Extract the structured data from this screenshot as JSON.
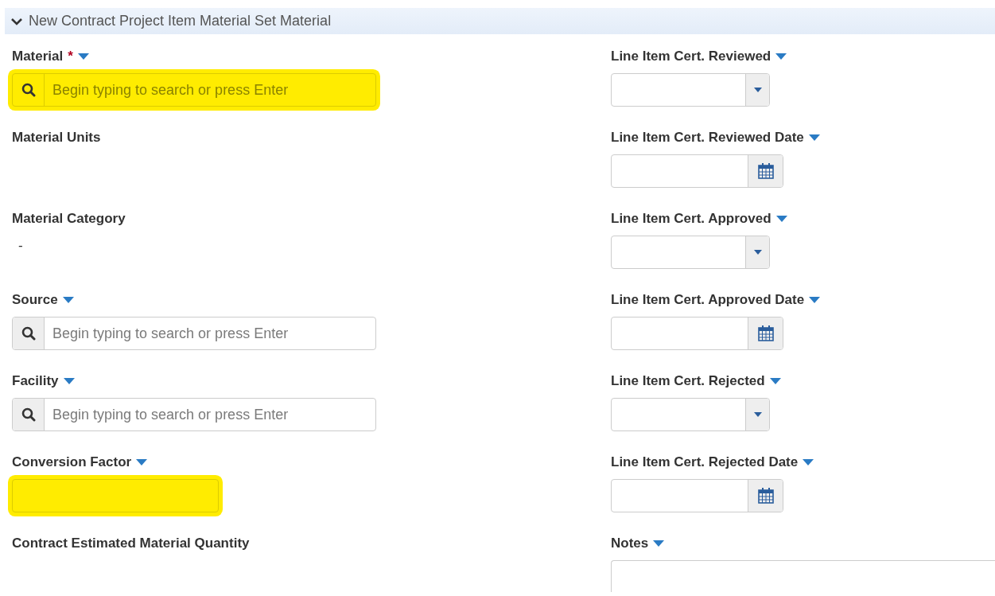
{
  "section": {
    "title": "New Contract Project Item Material Set Material",
    "expanded": true
  },
  "left_fields": [
    {
      "label": "Material",
      "required_mark": "*",
      "menu": true,
      "kind": "search",
      "placeholder": "Begin typing to search or press Enter",
      "highlighted": true
    },
    {
      "label": "Material Units",
      "menu": false,
      "kind": "static"
    },
    {
      "label": "Material Category",
      "menu": false,
      "kind": "static",
      "value": "-"
    },
    {
      "label": "Source",
      "menu": true,
      "kind": "search",
      "placeholder": "Begin typing to search or press Enter",
      "highlighted": false
    },
    {
      "label": "Facility",
      "menu": true,
      "kind": "search",
      "placeholder": "Begin typing to search or press Enter",
      "highlighted": false
    },
    {
      "label": "Conversion Factor",
      "menu": true,
      "kind": "input",
      "highlighted": true
    },
    {
      "label": "Contract Estimated Material Quantity",
      "menu": false,
      "kind": "static"
    }
  ],
  "right_fields": [
    {
      "label": "Line Item Cert. Reviewed",
      "menu": true,
      "kind": "select"
    },
    {
      "label": "Line Item Cert. Reviewed Date",
      "menu": true,
      "kind": "date"
    },
    {
      "label": "Line Item Cert. Approved",
      "menu": true,
      "kind": "select"
    },
    {
      "label": "Line Item Cert. Approved Date",
      "menu": true,
      "kind": "date"
    },
    {
      "label": "Line Item Cert. Rejected",
      "menu": true,
      "kind": "select"
    },
    {
      "label": "Line Item Cert. Rejected Date",
      "menu": true,
      "kind": "date"
    },
    {
      "label": "Notes",
      "menu": true,
      "kind": "textarea"
    }
  ]
}
